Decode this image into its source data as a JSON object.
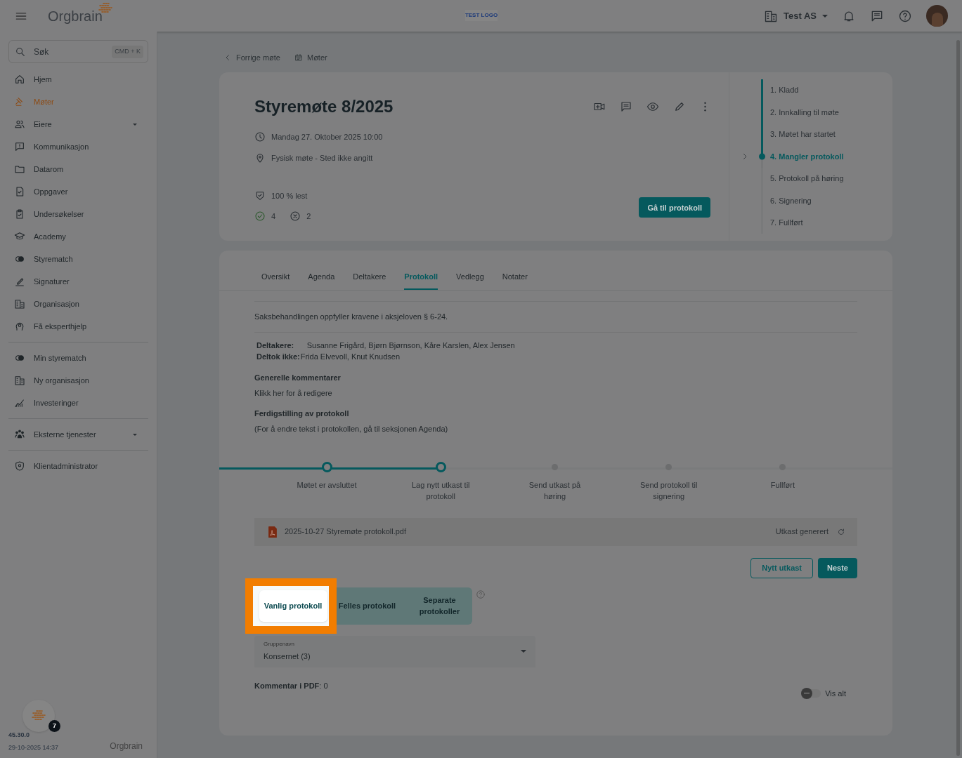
{
  "header": {
    "logo": "Orgbrain",
    "company_logo": "TEST LOGO",
    "organization": "Test AS"
  },
  "sidebar": {
    "search": {
      "placeholder": "Søk",
      "shortcut": "CMD + K"
    },
    "groups": [
      [
        {
          "label": "Hjem",
          "kind": "home",
          "selected": false,
          "expandable": false
        },
        {
          "label": "Møter",
          "kind": "gavel",
          "selected": true,
          "expandable": false
        },
        {
          "label": "Eiere",
          "kind": "people",
          "selected": false,
          "expandable": true
        },
        {
          "label": "Kommunikasjon",
          "kind": "alert",
          "selected": false,
          "expandable": false
        },
        {
          "label": "Datarom",
          "kind": "folder",
          "selected": false,
          "expandable": false
        },
        {
          "label": "Oppgaver",
          "kind": "task",
          "selected": false,
          "expandable": false
        },
        {
          "label": "Undersøkelser",
          "kind": "clipboard",
          "selected": false,
          "expandable": false
        },
        {
          "label": "Academy",
          "kind": "cap",
          "selected": false,
          "expandable": false
        },
        {
          "label": "Styrematch",
          "kind": "rings",
          "selected": false,
          "expandable": false
        },
        {
          "label": "Signaturer",
          "kind": "pen",
          "selected": false,
          "expandable": false
        },
        {
          "label": "Organisasjon",
          "kind": "building",
          "selected": false,
          "expandable": false
        },
        {
          "label": "Få eksperthjelp",
          "kind": "head",
          "selected": false,
          "expandable": false
        }
      ],
      [
        {
          "label": "Min styrematch",
          "kind": "rings",
          "selected": false,
          "expandable": false
        },
        {
          "label": "Ny organisasjon",
          "kind": "building",
          "selected": false,
          "expandable": false
        },
        {
          "label": "Investeringer",
          "kind": "chart",
          "selected": false,
          "expandable": false
        }
      ],
      [
        {
          "label": "Eksterne tjenester",
          "kind": "group",
          "selected": false,
          "expandable": true
        }
      ],
      [
        {
          "label": "Klientadministrator",
          "kind": "shield",
          "selected": false,
          "expandable": false
        }
      ]
    ],
    "badge": "7",
    "version": "45.30.0",
    "timestamp": "29-10-2025 14:37",
    "footer_logo": "Orgbrain"
  },
  "breadcrumbs": [
    {
      "label": "Forrige møte",
      "kind": "chevron"
    },
    {
      "label": "Møter",
      "kind": "calendar"
    }
  ],
  "meeting": {
    "title": "Styremøte 8/2025",
    "date": "Mandag 27. Oktober 2025 10:00",
    "location": "Fysisk møte - Sted ikke angitt",
    "read": "100 % lest",
    "accepted": "4",
    "declined": "2",
    "button": "Gå til protokoll"
  },
  "status_steps": [
    {
      "label": "1. Kladd",
      "selected": false
    },
    {
      "label": "2. Innkalling til møte",
      "selected": false
    },
    {
      "label": "3. Møtet har startet",
      "selected": false
    },
    {
      "label": "4. Mangler protokoll",
      "selected": true
    },
    {
      "label": "5. Protokoll på høring",
      "selected": false
    },
    {
      "label": "6. Signering",
      "selected": false
    },
    {
      "label": "7. Fullført",
      "selected": false
    }
  ],
  "tabs": [
    {
      "label": "Oversikt",
      "selected": false
    },
    {
      "label": "Agenda",
      "selected": false
    },
    {
      "label": "Deltakere",
      "selected": false
    },
    {
      "label": "Protokoll",
      "selected": true
    },
    {
      "label": "Vedlegg",
      "selected": false
    },
    {
      "label": "Notater",
      "selected": false
    }
  ],
  "protocol": {
    "statement": "Saksbehandlingen oppfyller kravene i aksjeloven § 6-24.",
    "participants_label": "Deltakere:",
    "participants": "Susanne Frigård, Bjørn Bjørnson, Kåre Karslen, Alex Jensen",
    "absent_label": "Deltok ikke:",
    "absent": "Frida Elvevoll, Knut Knudsen",
    "comments_heading": "Generelle kommentarer",
    "comments_hint": "Klikk her for å redigere",
    "completion_heading": "Ferdigstilling av protokoll",
    "completion_note": "(For å endre tekst i protokollen, gå til seksjonen Agenda)",
    "progress": [
      {
        "label": "Møtet er avsluttet",
        "done": true
      },
      {
        "label": "Lag nytt utkast til protokoll",
        "done": true
      },
      {
        "label": "Send utkast på høring",
        "done": false
      },
      {
        "label": "Send protokoll til signering",
        "done": false
      },
      {
        "label": "Fullført",
        "done": false
      }
    ],
    "file": {
      "name": "2025-10-27 Styremøte protokoll.pdf",
      "status": "Utkast generert"
    },
    "buttons": [
      "Nytt utkast",
      "Neste"
    ],
    "protocol_types": [
      {
        "label": "Vanlig protokoll",
        "selected": true
      },
      {
        "label": "Felles protokoll",
        "selected": false
      },
      {
        "label": "Separate protokoller",
        "selected": false
      }
    ],
    "group_select": {
      "label": "Gruppenavn",
      "value": "Konsernet (3)"
    },
    "comment_count": "**Kommentar i PDF**: 0",
    "show_all": {
      "label": "Vis alt",
      "on": false
    }
  }
}
